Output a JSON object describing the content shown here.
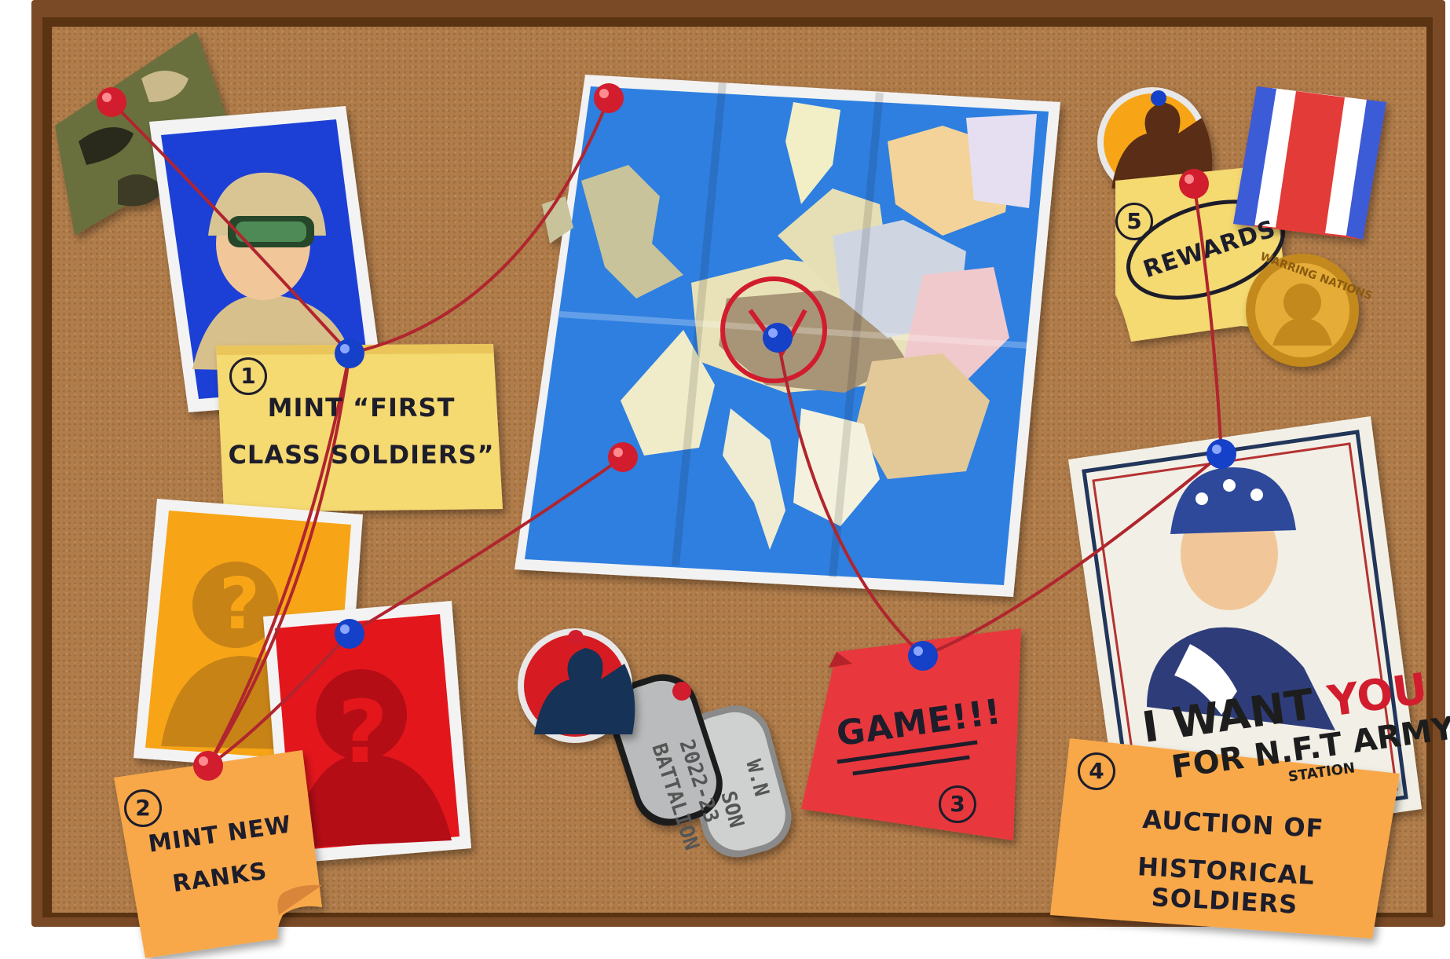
{
  "notes": {
    "note1": {
      "number": "1",
      "text_line1": "MINT “FIRST",
      "text_line2": "CLASS SOLDIERS”"
    },
    "note2": {
      "number": "2",
      "text_line1": "MINT NEW",
      "text_line2": "RANKS"
    },
    "note3": {
      "number": "3",
      "text": "GAME!!!"
    },
    "note4": {
      "number": "4",
      "text_line1": "AUCTION OF",
      "text_line2": "HISTORICAL SOLDIERS"
    },
    "note5": {
      "number": "5",
      "text": "REWARDS"
    }
  },
  "poster": {
    "headline_1": "I WANT ",
    "headline_2": "YOU",
    "subline": "FOR N.F.T ARMY",
    "footer": "STATION"
  },
  "medal": {
    "text": "WARRING NATIONS"
  },
  "dogtags": {
    "tag1_line1": "2022-23",
    "tag1_line2": "BATTALION",
    "tag2_line1": "W.N",
    "tag2_line2": "SON"
  },
  "colors": {
    "cork": "#b07c4a",
    "frame": "#7a4a26",
    "string": "#b0252e",
    "pin_red": "#d11d2d",
    "pin_blue": "#1540c8",
    "sticky_yellow": "#f5d971",
    "sticky_orange": "#f8a849",
    "sticky_red": "#e8393e"
  }
}
